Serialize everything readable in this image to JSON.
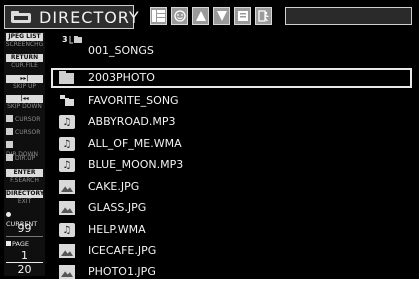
{
  "header": {
    "title": "DIRECTORY",
    "toolbar": [
      "grid-view-icon",
      "face-icon",
      "up-arrow-icon",
      "down-arrow-icon",
      "document-icon",
      "exit-icon"
    ]
  },
  "side_panel": {
    "keys": [
      {
        "key": "JPEG LIST",
        "label": "SCREENCHG"
      },
      {
        "key": "RETURN",
        "label": "CUR.FILE"
      },
      {
        "key": "▸▸|",
        "label": "SKIP UP"
      },
      {
        "key": "|◂◂",
        "label": "SKIP DOWN"
      }
    ],
    "cursor_rows": [
      "CURSOR",
      "CURSOR",
      "DIR.DOWN",
      "DIR.UP"
    ],
    "enter": {
      "key": "ENTER",
      "label": "F.SEARCH"
    },
    "directory": {
      "key": "DIRECTORY",
      "label": "EXIT"
    },
    "current": {
      "label": "CURRENT",
      "value": "99"
    },
    "page": {
      "label": "PAGE",
      "current": "1",
      "total": "20"
    }
  },
  "list": {
    "root": {
      "number": "3",
      "name": "001_SONGS"
    },
    "items": [
      {
        "type": "folder",
        "name": "2003PHOTO",
        "selected": true
      },
      {
        "type": "folder-open",
        "name": "FAVORITE_SONG"
      },
      {
        "type": "audio",
        "name": "ABBYROAD.MP3"
      },
      {
        "type": "audio",
        "name": "ALL_OF_ME.WMA"
      },
      {
        "type": "audio",
        "name": "BLUE_MOON.MP3"
      },
      {
        "type": "photo",
        "name": "CAKE.JPG"
      },
      {
        "type": "photo",
        "name": "GLASS.JPG"
      },
      {
        "type": "audio",
        "name": "HELP.WMA"
      },
      {
        "type": "photo",
        "name": "ICECAFE.JPG"
      },
      {
        "type": "photo",
        "name": "PHOTO1.JPG"
      }
    ]
  },
  "colors": {
    "background": "#000000",
    "text": "#f3f3f3",
    "button": "#9a9a9a",
    "key": "#dcdcdc"
  }
}
